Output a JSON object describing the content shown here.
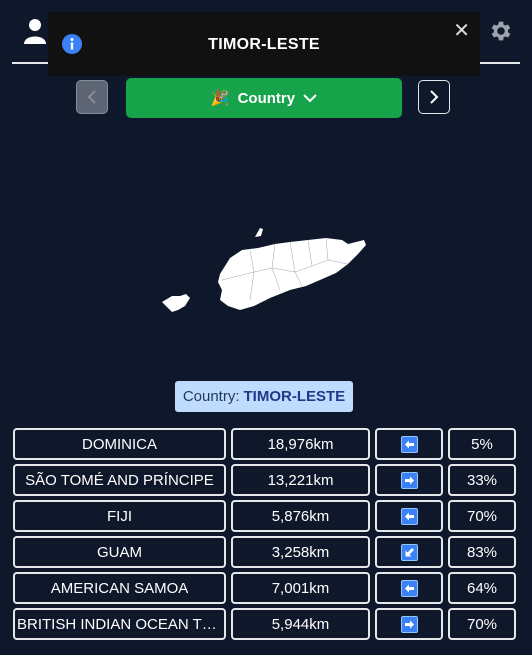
{
  "toast": {
    "title": "TIMOR-LESTE",
    "icon": "info-icon"
  },
  "mode": {
    "emoji": "🎉",
    "label": "Country"
  },
  "answer": {
    "prefix": "Country:",
    "name": "TIMOR-LESTE"
  },
  "guesses": [
    {
      "name": "DOMINICA",
      "distance": "18,976km",
      "direction": "left",
      "percent": "5%"
    },
    {
      "name": "SÃO TOMÉ AND PRÍNCIPE",
      "distance": "13,221km",
      "direction": "right",
      "percent": "33%"
    },
    {
      "name": "FIJI",
      "distance": "5,876km",
      "direction": "left",
      "percent": "70%"
    },
    {
      "name": "GUAM",
      "distance": "3,258km",
      "direction": "down-left",
      "percent": "83%"
    },
    {
      "name": "AMERICAN SAMOA",
      "distance": "7,001km",
      "direction": "left",
      "percent": "64%"
    },
    {
      "name": "BRITISH INDIAN OCEAN TE...",
      "distance": "5,944km",
      "direction": "right",
      "percent": "70%"
    }
  ],
  "colors": {
    "background": "#0f172a",
    "accent_green": "#16a34a",
    "answer_bg": "#bfdbfe",
    "arrow_blue": "#3b82f6"
  }
}
